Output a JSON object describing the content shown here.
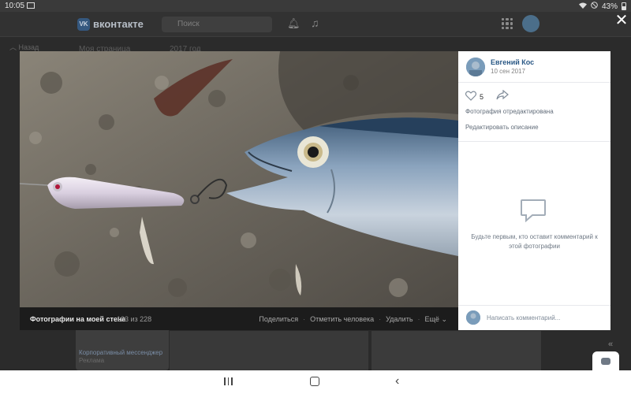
{
  "status_bar": {
    "time": "10:05",
    "battery": "43%"
  },
  "background_page": {
    "brand": "вконтакте",
    "search_placeholder": "Поиск",
    "nav_back": "Назад",
    "menu_item": "Моя страница",
    "year": "2017 год",
    "card_text": "Корпоративный мессенджер",
    "card_subtext": "Реклама"
  },
  "photo_footer": {
    "album_title": "Фотографии на моей стене",
    "counter": "133 из 228",
    "actions": [
      "Поделиться",
      "Отметить человека",
      "Удалить",
      "Ещё"
    ]
  },
  "side_panel": {
    "author_name": "Евгений Кос",
    "date": "10 сен 2017",
    "likes_count": "5",
    "edited_note": "Фотография отредактирована",
    "edit_description": "Редактировать описание",
    "empty_comments": "Будьте первым, кто оставит комментарий к этой фотографии",
    "comment_placeholder": "Написать комментарий..."
  },
  "colors": {
    "link": "#2a5885",
    "secondary_text": "#626d7a",
    "footer_bg": "#1c1c1c"
  },
  "icons": {
    "close": "close-icon",
    "like": "heart-icon",
    "share": "share-arrow-icon",
    "comments_empty": "speech-bubble-icon"
  }
}
